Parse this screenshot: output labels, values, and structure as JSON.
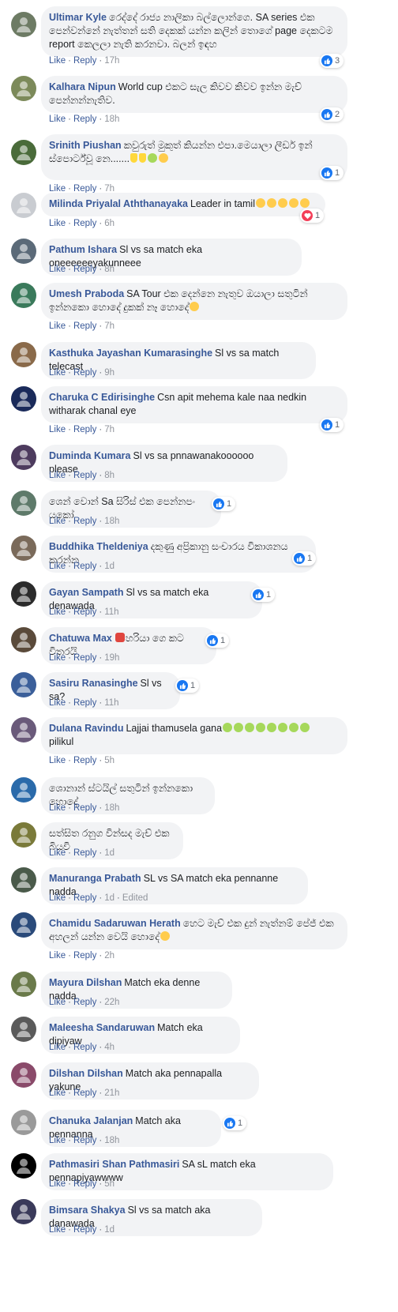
{
  "actions": {
    "like": "Like",
    "reply": "Reply",
    "sep": "·"
  },
  "colors": {
    "name": "#385898",
    "bubble": "#f2f3f5",
    "like_blue": "#1877f2",
    "love_red": "#f33e58"
  },
  "comments": [
    {
      "name": "Ultimar Kyle",
      "text": "රෙද්දේ රාජ්‍ය නාලිකා බල්ලොන්ගෙ. SA series එක පෙන්වන්නේ නැත්තන් සති දෙකක් යන්න කලින් තොගේ page දෙකටම report කෙලලා නැති කරනවා. බලන් ඉඳහ",
      "time": "17h",
      "reaction": {
        "type": "like",
        "count": "3"
      },
      "avatar": {
        "color": "#6d7b64",
        "icon": "avatar-icon"
      }
    },
    {
      "name": "Kalhara Nipun",
      "text": "World cup එකට සැල කිවව කිවව ඉන්න මැච් පෙන්නන්නැතිව.",
      "time": "18h",
      "reaction": {
        "type": "like",
        "count": "2"
      },
      "avatar": {
        "color": "#7c8a5a",
        "icon": "avatar-icon"
      }
    },
    {
      "name": "Srinith Piushan",
      "text": "කවුරුත් මුකුත් කියන්න එපා.මෙයාලා ලීඩර් ඉන් ස්පොර්ට්වූ නෙ.......",
      "time": "7h",
      "reaction": {
        "type": "like",
        "count": "1"
      },
      "avatar": {
        "color": "#4a6b3a",
        "icon": "avatar-icon"
      },
      "emojis": [
        "hands",
        "hands",
        "sick",
        "worried"
      ]
    },
    {
      "name": "Milinda Priyalal Aththanayaka",
      "text": "Leader in tamil",
      "time": "6h",
      "reaction": {
        "type": "love",
        "count": "1"
      },
      "avatar": {
        "color": "#c9ccd1",
        "icon": "avatar-icon"
      },
      "emojis": [
        "grin",
        "grin",
        "grin",
        "grin",
        "grin"
      ]
    },
    {
      "name": "Pathum Ishara",
      "text": "Sl vs sa match eka oneeeeeeyakunneee",
      "time": "8h",
      "reaction": null,
      "avatar": {
        "color": "#5b6a78",
        "icon": "avatar-icon"
      }
    },
    {
      "name": "Umesh Praboda",
      "text": "SA Tour එක දෙන්නෙ නැතුව ඔයාලා සතුටින් ඉන්නකො හොදේ දුකක් නෑ හොදේ",
      "time": "7h",
      "reaction": null,
      "avatar": {
        "color": "#3a7a5b",
        "icon": "avatar-icon"
      },
      "emojis": [
        "sad"
      ]
    },
    {
      "name": "Kasthuka Jayashan Kumarasinghe",
      "text": "Sl vs sa match telecast",
      "time": "9h",
      "reaction": null,
      "avatar": {
        "color": "#8a6a4a",
        "icon": "avatar-icon"
      }
    },
    {
      "name": "Charuka C Edirisinghe",
      "text": "Csn apit mehema kale naa nedkin witharak chanal eye",
      "time": "7h",
      "reaction": {
        "type": "like",
        "count": "1"
      },
      "avatar": {
        "color": "#1a2a5a",
        "icon": "avatar-icon"
      }
    },
    {
      "name": "Duminda Kumara",
      "text": "Sl vs sa pnnawanakoooooo please",
      "time": "8h",
      "reaction": null,
      "avatar": {
        "color": "#4d3b5e",
        "icon": "avatar-icon"
      }
    },
    {
      "name": "",
      "text": "ශෙන් වොන් Sa සිරිස් එක පෙන්නපං යකෝ",
      "time": "18h",
      "reaction": {
        "type": "like",
        "count": "1"
      },
      "avatar": {
        "color": "#5e7a6a",
        "icon": "avatar-icon"
      }
    },
    {
      "name": "Buddhika Theldeniya",
      "text": "දකුණු අප්‍රිකානු සංචාරය විකාශනය කරන්න",
      "time": "1d",
      "reaction": {
        "type": "like",
        "count": "1"
      },
      "avatar": {
        "color": "#7a6a5a",
        "icon": "avatar-icon"
      }
    },
    {
      "name": "Gayan Sampath",
      "text": "Sl vs sa match eka denawada",
      "time": "11h",
      "reaction": {
        "type": "like",
        "count": "1"
      },
      "avatar": {
        "color": "#2b2b2b",
        "icon": "avatar-icon"
      }
    },
    {
      "name": "Chatuwa Max",
      "text": "හරියා ගෙ කට විතරයි",
      "time": "19h",
      "reaction": {
        "type": "like",
        "count": "1"
      },
      "avatar": {
        "color": "#5a4a3a",
        "icon": "avatar-icon"
      },
      "emojis_before": [
        "hot"
      ]
    },
    {
      "name": "Sasiru Ranasinghe",
      "text": "Sl vs sa?",
      "time": "11h",
      "reaction": {
        "type": "like",
        "count": "1"
      },
      "avatar": {
        "color": "#3b5f9a",
        "icon": "avatar-icon"
      }
    },
    {
      "name": "Dulana Ravindu",
      "text": "Lajjai thamusela gana",
      "text2": "pilikul",
      "time": "5h",
      "reaction": null,
      "avatar": {
        "color": "#6a5a7a",
        "icon": "avatar-icon"
      },
      "emojis": [
        "sick",
        "sick",
        "sick",
        "sick",
        "sick",
        "sick",
        "sick",
        "sick"
      ]
    },
    {
      "name": "",
      "text": "ශොනාන් ස්ටයිල් සතුටින් ඉන්නකො හොදේ",
      "time": "18h",
      "reaction": null,
      "avatar": {
        "color": "#2a6aaa",
        "icon": "avatar-icon"
      }
    },
    {
      "name": "",
      "text": "සත්සිත රනුග වින්සද මැච් එක බියවි",
      "time": "1d",
      "reaction": null,
      "avatar": {
        "color": "#7a7a3a",
        "icon": "avatar-icon"
      }
    },
    {
      "name": "Manuranga Prabath",
      "text": "SL vs SA match eka pennanne nadda",
      "time": "1d",
      "edited": "Edited",
      "reaction": null,
      "avatar": {
        "color": "#4a5a4a",
        "icon": "avatar-icon"
      }
    },
    {
      "name": "Chamidu Sadaruwan Herath",
      "text": "හෙට මැච් එක දුන් නැත්නම් පේජ් එක අහලන් යන්න වෙයි හොදේ",
      "time": "2h",
      "reaction": null,
      "avatar": {
        "color": "#2a4a7a",
        "icon": "avatar-icon"
      },
      "emojis": [
        "laugh"
      ]
    },
    {
      "name": "Mayura Dilshan",
      "text": "Match eka denne nadda",
      "time": "22h",
      "reaction": null,
      "avatar": {
        "color": "#6a7a4a",
        "icon": "avatar-icon"
      }
    },
    {
      "name": "Maleesha Sandaruwan",
      "text": "Match eka dipiyaw",
      "time": "4h",
      "reaction": null,
      "avatar": {
        "color": "#5a5a5a",
        "icon": "avatar-icon"
      }
    },
    {
      "name": "Dilshan Dilshan",
      "text": "Match aka pennapalla yakune",
      "time": "21h",
      "reaction": null,
      "avatar": {
        "color": "#8a4a6a",
        "icon": "avatar-icon"
      }
    },
    {
      "name": "Chanuka Jalanjan",
      "text": "Match aka pennanna",
      "time": "18h",
      "reaction": {
        "type": "like",
        "count": "1"
      },
      "avatar": {
        "color": "#9a9a9a",
        "icon": "avatar-icon"
      }
    },
    {
      "name": "Pathmasiri Shan Pathmasiri",
      "text": "SA sL match eka pennapiyawwww",
      "time": "5h",
      "reaction": null,
      "avatar": {
        "color": "#000000",
        "icon": "avatar-icon"
      }
    },
    {
      "name": "Bimsara Shakya",
      "text": "Sl vs sa match aka danawada",
      "time": "1d",
      "reaction": null,
      "avatar": {
        "color": "#3a3a5a",
        "icon": "avatar-icon"
      }
    }
  ]
}
